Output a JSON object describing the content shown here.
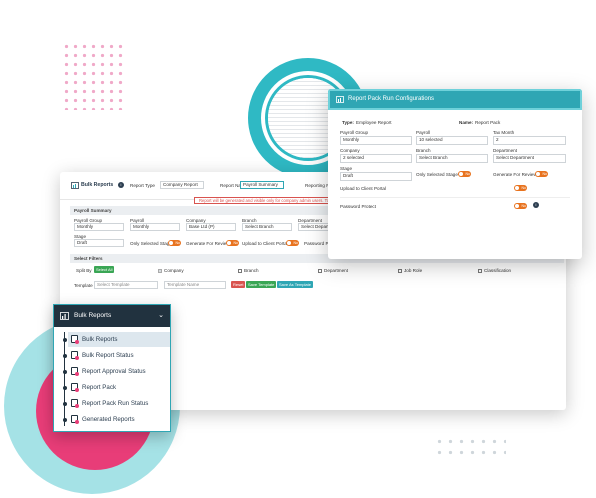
{
  "colors": {
    "accent": "#2fa6b4",
    "toggle": "#e8731f",
    "danger": "#d9534f",
    "pink": "#e83d78",
    "nav_dark": "#21323f"
  },
  "main": {
    "title": "Bulk Reports",
    "report_type_label": "Report Type",
    "report_type_value": "Company Report",
    "report_name_label": "Report Name",
    "report_name_value": "Payroll Summary",
    "reporting_period_label": "Reporting Period",
    "banner": "Report will be generated and visible only for company admin users. To view",
    "payroll_summary": {
      "section": "Payroll Summary",
      "payroll_group_label": "Payroll Group",
      "payroll_group_value": "Monthly",
      "payroll_label": "Payroll",
      "payroll_value": "Monthly",
      "company_label": "Company",
      "company_value": "Base Ltd (P)",
      "branch_label": "Branch",
      "branch_value": "Select Branch",
      "department_label": "Department",
      "department_value": "Select Department",
      "stage_label": "Stage",
      "stage_value": "Draft",
      "only_selected_stage": "Only Selected Stage?",
      "generate_for_review": "Generate For Review",
      "upload_client_portal": "Upload to Client Portal",
      "password_protect": "Password Protect",
      "toggle_no": "No"
    },
    "filters": {
      "section": "Select Filters",
      "split_by_label": "Split By",
      "select_all": "Select All",
      "options": [
        "Company",
        "Branch",
        "Department",
        "Job Role",
        "Classification"
      ],
      "template_label": "Template",
      "template_placeholder": "Select Template",
      "template_name_placeholder": "Template Name",
      "reset": "Reset",
      "save_template": "Save Template",
      "save_as_template": "Save As Template"
    }
  },
  "popup": {
    "title": "Report Pack Run Configurations",
    "type_label": "Type:",
    "type_value": "Employee Report",
    "name_label": "Name:",
    "name_value": "Report Pack",
    "payroll_group_label": "Payroll Group",
    "payroll_group_value": "Monthly",
    "payroll_label": "Payroll",
    "payroll_value": "10 selected",
    "tax_month_label": "Tax Month",
    "tax_month_value": "2",
    "company_label": "Company",
    "company_value": "2 selected",
    "branch_label": "Branch",
    "branch_value": "Select Branch",
    "department_label": "Department",
    "department_value": "Select Department",
    "stage_label": "Stage",
    "stage_value": "Draft",
    "only_selected_stage": "Only Selected Stage",
    "generate_for_review": "Generate For Review",
    "upload_client_portal": "Upload to Client Portal",
    "password_protect": "Password Protect",
    "toggle_no": "No"
  },
  "side": {
    "title": "Bulk Reports",
    "items": [
      "Bulk Reports",
      "Bulk Report Status",
      "Report Approval Status",
      "Report Pack",
      "Report Pack Run Status",
      "Generated Reports"
    ]
  }
}
